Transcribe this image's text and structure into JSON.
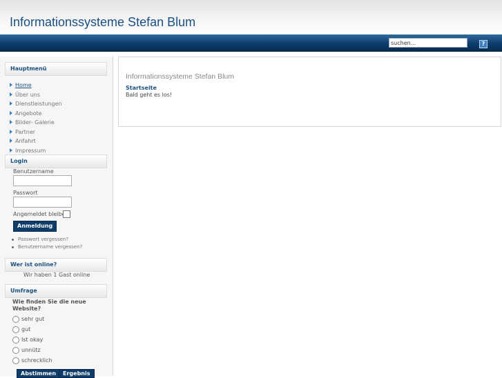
{
  "site": {
    "title": "Informationssysteme Stefan Blum"
  },
  "search": {
    "value": "suchen...",
    "help_label": "?"
  },
  "main_menu": {
    "title": "Hauptmenü",
    "items": [
      {
        "label": "Home",
        "active": true
      },
      {
        "label": "Über uns"
      },
      {
        "label": "Dienstleistungen"
      },
      {
        "label": "Angebote"
      },
      {
        "label": "Bilder- Galerie"
      },
      {
        "label": "Partner"
      },
      {
        "label": "Anfahrt"
      },
      {
        "label": "Impressum"
      }
    ]
  },
  "login": {
    "title": "Login",
    "username_label": "Benutzername",
    "password_label": "Passwort",
    "remember_label": "Angemeldet bleiben",
    "submit_label": "Anmeldung",
    "links": [
      "Passwort vergessen?",
      "Benutzername vergessen?"
    ]
  },
  "online": {
    "title": "Wer ist online?",
    "text": "Wir haben 1 Gast online"
  },
  "poll": {
    "title": "Umfrage",
    "question_line1": "Wie finden Sie die neue",
    "question_line2": "Website?",
    "options": [
      "sehr gut",
      "gut",
      "Ist okay",
      "unnütz",
      "schrecklich"
    ],
    "vote_label": "Abstimmen",
    "results_label": "Ergebnis"
  },
  "content": {
    "heading": "Informationssysteme Stefan Blum",
    "subheading": "Startseite",
    "text": "Bald geht es los!"
  },
  "colors": {
    "brand_blue": "#1a4f82",
    "navbar": "#0d3b6a",
    "button": "#0f3d6b"
  }
}
